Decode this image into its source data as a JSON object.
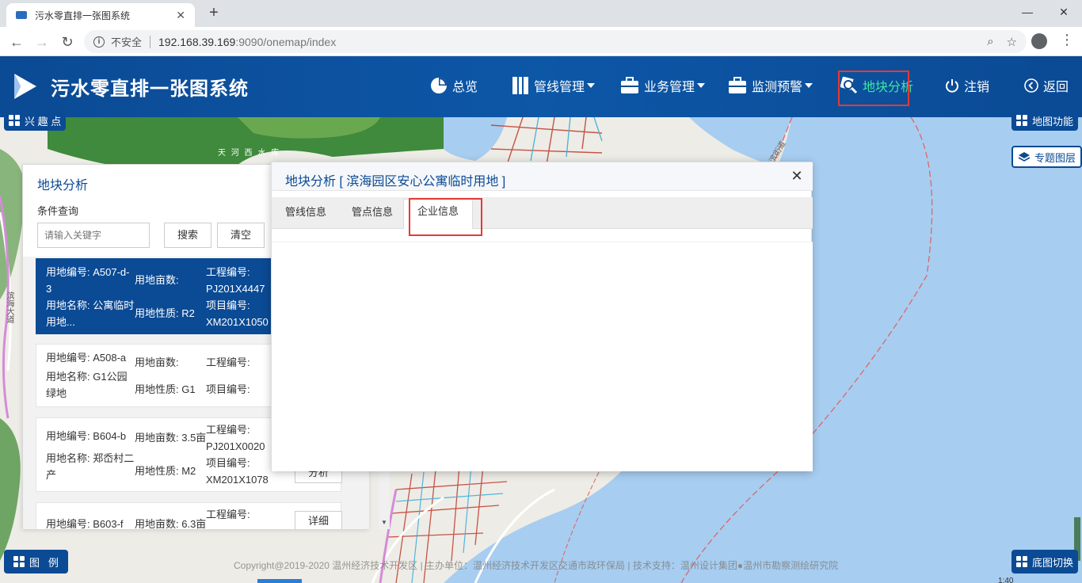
{
  "browser": {
    "tab_title": "污水零直排一张图系统",
    "tab_close": "✕",
    "new_tab": "+",
    "minimize": "—",
    "maximize": "❐",
    "close": "✕",
    "insecure_label": "不安全",
    "url_host": "192.168.39.169",
    "url_path": ":9090/onemap/index"
  },
  "header": {
    "title": "污水零直排一张图系统",
    "nav": [
      {
        "label": "总览",
        "icon": "pie-chart-icon"
      },
      {
        "label": "管线管理",
        "icon": "columns-icon"
      },
      {
        "label": "业务管理",
        "icon": "briefcase-icon"
      },
      {
        "label": "监测预警",
        "icon": "briefcase-icon"
      },
      {
        "label": "地块分析",
        "icon": "search-map-icon"
      },
      {
        "label": "注销",
        "icon": "power-icon"
      },
      {
        "label": "返回",
        "icon": "back-circle-icon"
      }
    ],
    "active_color": "#3ee6a6",
    "bg_color": "#0b4a94"
  },
  "map": {
    "poi_button": "兴 趣 点",
    "map_functions_button": "地图功能",
    "topic_layers_button": "专题图层",
    "legend_button": "图   例",
    "basemap_button": "底图切换",
    "footer": "Copyright@2019-2020 温州经济技术开发区 | 主办单位：温州经济技术开发区交通市政环保局 | 技术支持：温州设计集团●温州市勘察测绘研究院",
    "place_labels": [
      "天  河  西  水  库",
      "海滨街道",
      "滨海",
      "滨海大道"
    ]
  },
  "left_panel": {
    "title": "地块分析",
    "section_label": "条件查询",
    "search_placeholder": "请输入关键字",
    "search_button": "搜索",
    "clear_button": "清空",
    "cards": [
      {
        "land_no": "用地编号: A507-d-3",
        "land_name": "用地名称: 公寓临时用地...",
        "area": "用地亩数:",
        "nature": "用地性质: R2",
        "project_no": "工程编号: PJ201X4447",
        "item_no": "项目编号: XM201X1050"
      },
      {
        "land_no": "用地编号: A508-a",
        "land_name": "用地名称: G1公园绿地",
        "area": "用地亩数:",
        "nature": "用地性质: G1",
        "project_no": "工程编号:",
        "item_no": "项目编号:"
      },
      {
        "land_no": "用地编号: B604-b",
        "land_name": "用地名称: 郑岙村二产",
        "area": "用地亩数: 3.5亩",
        "nature": "用地性质: M2",
        "project_no": "工程编号: PJ201X0020",
        "item_no": "项目编号: XM201X1078",
        "action": "分析"
      },
      {
        "land_no": "用地编号: B603-f",
        "land_name": "",
        "area": "用地亩数: 6.3亩",
        "nature": "",
        "project_no": "工程编号:",
        "item_no": "",
        "action": "详细"
      }
    ]
  },
  "dialog": {
    "title": "地块分析 [ 滨海园区安心公寓临时用地 ]",
    "close": "✕",
    "tabs": [
      "管线信息",
      "管点信息",
      "企业信息"
    ],
    "active_tab": "企业信息"
  }
}
